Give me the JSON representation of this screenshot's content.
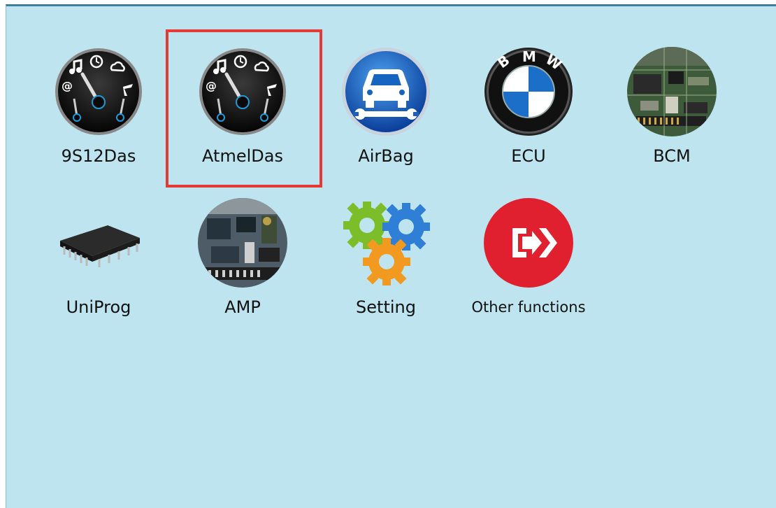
{
  "apps": [
    {
      "label": "9S12Das",
      "icon": "gauge-icon"
    },
    {
      "label": "AtmelDas",
      "icon": "gauge-icon",
      "selected": true
    },
    {
      "label": "AirBag",
      "icon": "car-wrench-icon"
    },
    {
      "label": "ECU",
      "icon": "bmw-logo-icon"
    },
    {
      "label": "BCM",
      "icon": "circuit-board-icon"
    },
    {
      "label": "UniProg",
      "icon": "chip-icon"
    },
    {
      "label": "AMP",
      "icon": "circuit-board-icon"
    },
    {
      "label": "Setting",
      "icon": "gears-icon"
    },
    {
      "label": "Other functions",
      "icon": "exit-arrow-icon"
    }
  ],
  "bmw_letters": [
    "B",
    "M",
    "W"
  ],
  "colors": {
    "background": "#bde4ef",
    "selection_border": "#e53935",
    "airbag_blue": "#1565c0",
    "other_red": "#e0202e"
  }
}
